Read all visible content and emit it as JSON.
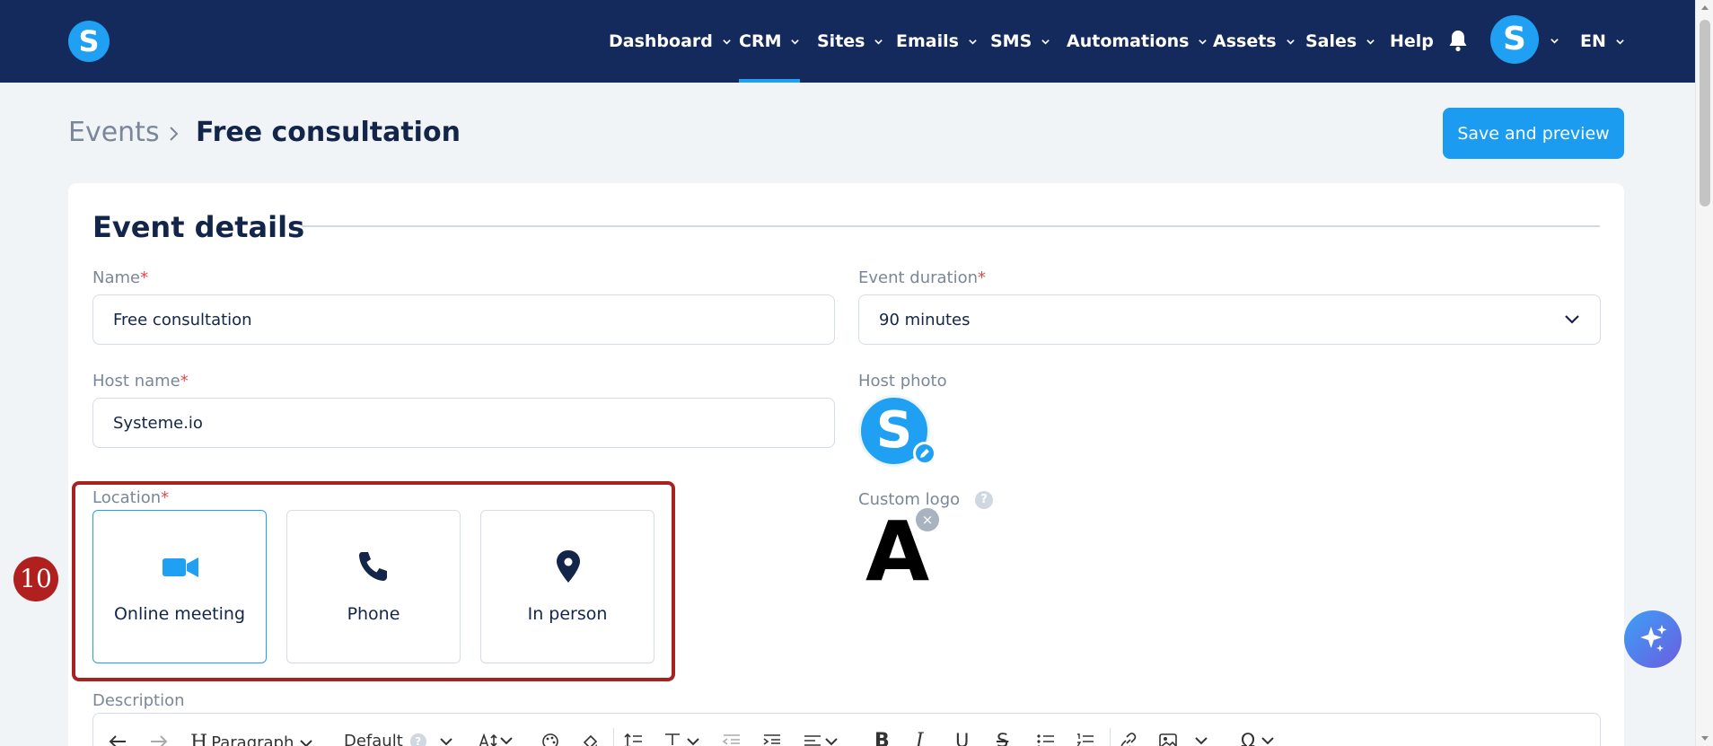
{
  "brand": {
    "logo_letter": "S"
  },
  "nav": {
    "items": [
      {
        "label": "Dashboard",
        "dropdown": true
      },
      {
        "label": "CRM",
        "dropdown": true,
        "active": true
      },
      {
        "label": "Sites",
        "dropdown": true
      },
      {
        "label": "Emails",
        "dropdown": true
      },
      {
        "label": "SMS",
        "dropdown": true
      },
      {
        "label": "Automations",
        "dropdown": true
      },
      {
        "label": "Assets",
        "dropdown": true
      },
      {
        "label": "Sales",
        "dropdown": true
      },
      {
        "label": "Help",
        "dropdown": false
      }
    ],
    "avatar_letter": "S",
    "language": "EN",
    "icons": {
      "notifications": "bell-icon"
    }
  },
  "breadcrumb": {
    "parent": "Events",
    "current": "Free consultation"
  },
  "header": {
    "save_label": "Save and preview"
  },
  "card": {
    "title": "Event details",
    "name": {
      "label": "Name",
      "value": "Free consultation"
    },
    "duration": {
      "label": "Event duration",
      "value": "90 minutes"
    },
    "host_name": {
      "label": "Host name",
      "value": "Systeme.io"
    },
    "host_photo": {
      "label": "Host photo",
      "letter": "S"
    },
    "location": {
      "label": "Location",
      "options": [
        {
          "label": "Online meeting",
          "icon": "video-camera-icon",
          "selected": true
        },
        {
          "label": "Phone",
          "icon": "phone-icon",
          "selected": false
        },
        {
          "label": "In person",
          "icon": "map-pin-icon",
          "selected": false
        }
      ]
    },
    "custom_logo": {
      "label": "Custom logo",
      "help": "?",
      "logo_text": "A",
      "remove": "×"
    },
    "description": {
      "label": "Description",
      "toolbar": {
        "paragraph": "Paragraph",
        "font": "Default",
        "help": "?"
      }
    }
  },
  "step_badge": "10",
  "required_mark": "*",
  "colors": {
    "nav_bg": "#142a5c",
    "accent": "#1fa0f2",
    "highlight_frame": "#a8221f"
  }
}
